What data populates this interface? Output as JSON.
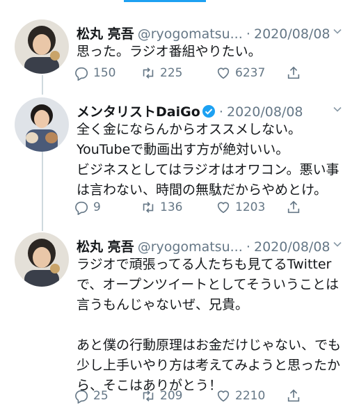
{
  "tweets": [
    {
      "name": "松丸 亮吾",
      "handle": "@ryogomatsu...",
      "date": "2020/08/08",
      "text": "思った。ラジオ番組やりたい。",
      "verified": false,
      "replies": "150",
      "retweets": "225",
      "likes": "6237"
    },
    {
      "name": "メンタリストDaiGo",
      "handle": "",
      "date": "2020/08/08",
      "text": "全く金にならんからオススメしない。\nYouTubeで動画出す方が絶対いい。\nビジネスとしてはラジオはオワコン。悪い事\nは言わない、時間の無駄だからやめとけ。",
      "verified": true,
      "replies": "9",
      "retweets": "136",
      "likes": "1203"
    },
    {
      "name": "松丸 亮吾",
      "handle": "@ryogomatsu...",
      "date": "2020/08/08",
      "text": "ラジオで頑張ってる人たちも見てるTwitter\nで、オープンツイートとしてそういうことは\n言うもんじゃないぜ、兄貴。\n\nあと僕の行動原理はお金だけじゃない、でも\n少し上手いやり方は考えてみようと思ったか\nら、そこはありがとう！",
      "verified": false,
      "replies": "25",
      "retweets": "209",
      "likes": "2210"
    }
  ],
  "separator": "·",
  "colors": {
    "accent": "#1da1f2",
    "text": "#14171a",
    "muted": "#657786",
    "thread": "#cfd9de"
  },
  "icons": [
    "reply-icon",
    "retweet-icon",
    "like-icon",
    "share-icon",
    "verified-icon",
    "chevron-down-icon"
  ]
}
